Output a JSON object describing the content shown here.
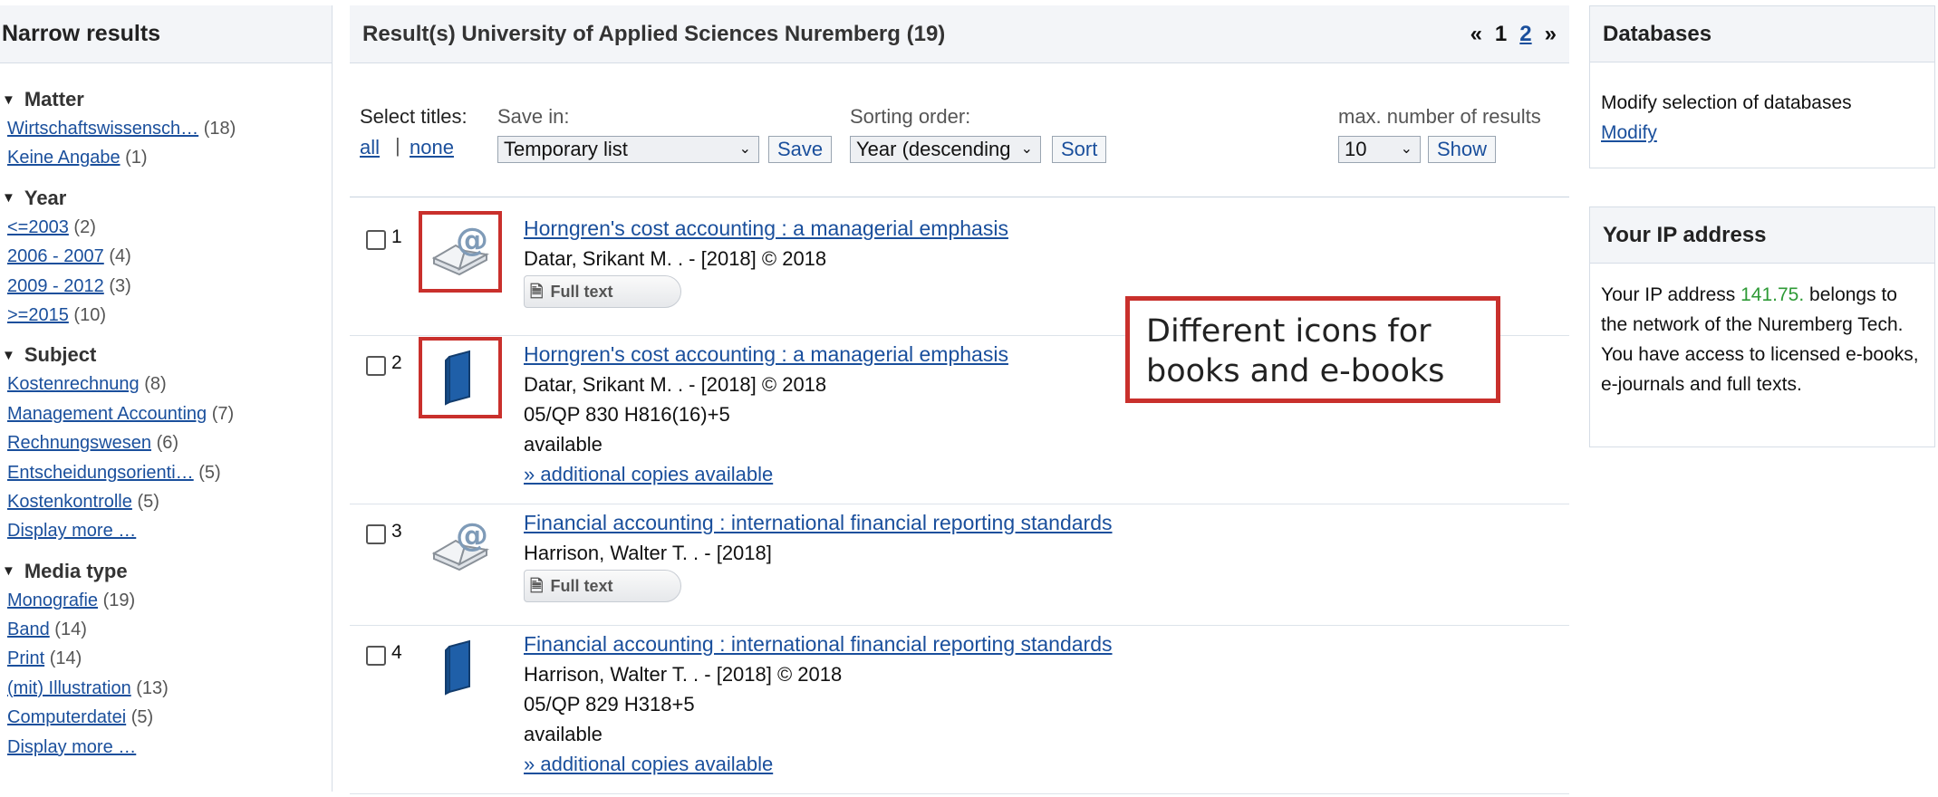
{
  "sidebar": {
    "title": "Narrow results",
    "facets": [
      {
        "title": "Matter",
        "items": [
          {
            "label": "Wirtschaftswissensch…",
            "count": "(18)"
          },
          {
            "label": "Keine Angabe",
            "count": "(1)"
          }
        ]
      },
      {
        "title": "Year",
        "items": [
          {
            "label": "<=2003",
            "count": "(2)"
          },
          {
            "label": "2006 - 2007",
            "count": "(4)"
          },
          {
            "label": "2009 - 2012",
            "count": "(3)"
          },
          {
            "label": ">=2015",
            "count": "(10)"
          }
        ]
      },
      {
        "title": "Subject",
        "items": [
          {
            "label": "Kostenrechnung",
            "count": "(8)"
          },
          {
            "label": "Management Accounting",
            "count": "(7)"
          },
          {
            "label": "Rechnungswesen",
            "count": "(6)"
          },
          {
            "label": "Entscheidungsorienti…",
            "count": "(5)"
          },
          {
            "label": "Kostenkontrolle",
            "count": "(5)"
          },
          {
            "label": "Display more …",
            "count": ""
          }
        ]
      },
      {
        "title": "Media type",
        "items": [
          {
            "label": "Monografie",
            "count": "(19)"
          },
          {
            "label": "Band",
            "count": "(14)"
          },
          {
            "label": "Print",
            "count": "(14)"
          },
          {
            "label": "(mit) Illustration",
            "count": "(13)"
          },
          {
            "label": "Computerdatei",
            "count": "(5)"
          },
          {
            "label": "Display more …",
            "count": ""
          }
        ]
      }
    ]
  },
  "results_header": {
    "title": "Result(s) University of Applied Sciences Nuremberg (19)",
    "pager_prev": "«",
    "pager_current": "1",
    "pager_next_page": "2",
    "pager_next": "»"
  },
  "controls": {
    "select_titles_label": "Select titles:",
    "all": "all",
    "separator": "|",
    "none": "none",
    "save_in_label": "Save in:",
    "save_in_value": "Temporary list",
    "save_button": "Save",
    "sorting_label": "Sorting order:",
    "sorting_value": "Year (descending",
    "sort_button": "Sort",
    "max_label": "max. number of results",
    "max_value": "10",
    "show_button": "Show"
  },
  "results": [
    {
      "num": "1",
      "icon": "ebook-icon",
      "title": "Horngren's cost accounting : a managerial emphasis",
      "author": "Datar, Srikant M. . - [2018] © 2018",
      "fulltext": "Full text"
    },
    {
      "num": "2",
      "icon": "book-icon",
      "title": "Horngren's cost accounting : a managerial emphasis",
      "author": "Datar, Srikant M. . - [2018] © 2018",
      "callno": "05/QP 830 H816(16)+5",
      "status": "available",
      "copies": "» additional copies available"
    },
    {
      "num": "3",
      "icon": "ebook-icon",
      "title": "Financial accounting : international financial reporting standards",
      "author": "Harrison, Walter T. . - [2018]",
      "fulltext": "Full text"
    },
    {
      "num": "4",
      "icon": "book-icon",
      "title": "Financial accounting : international financial reporting standards",
      "author": "Harrison, Walter T. . - [2018] © 2018",
      "callno": "05/QP 829 H318+5",
      "status": "available",
      "copies": "» additional copies available"
    }
  ],
  "annotation": {
    "line1": "Different icons for",
    "line2": "books and e-books"
  },
  "databases": {
    "title": "Databases",
    "text": "Modify selection of databases",
    "link": "Modify"
  },
  "ip_box": {
    "title": "Your IP address",
    "prefix": "Your IP address",
    "ip": "141.75.",
    "text": "belongs to the network of the Nuremberg Tech. You have access to licensed e-books, e-journals and full texts."
  },
  "colors": {
    "accent": "#c9302c",
    "link": "#1a4f9c",
    "ip": "#2e9a36"
  }
}
